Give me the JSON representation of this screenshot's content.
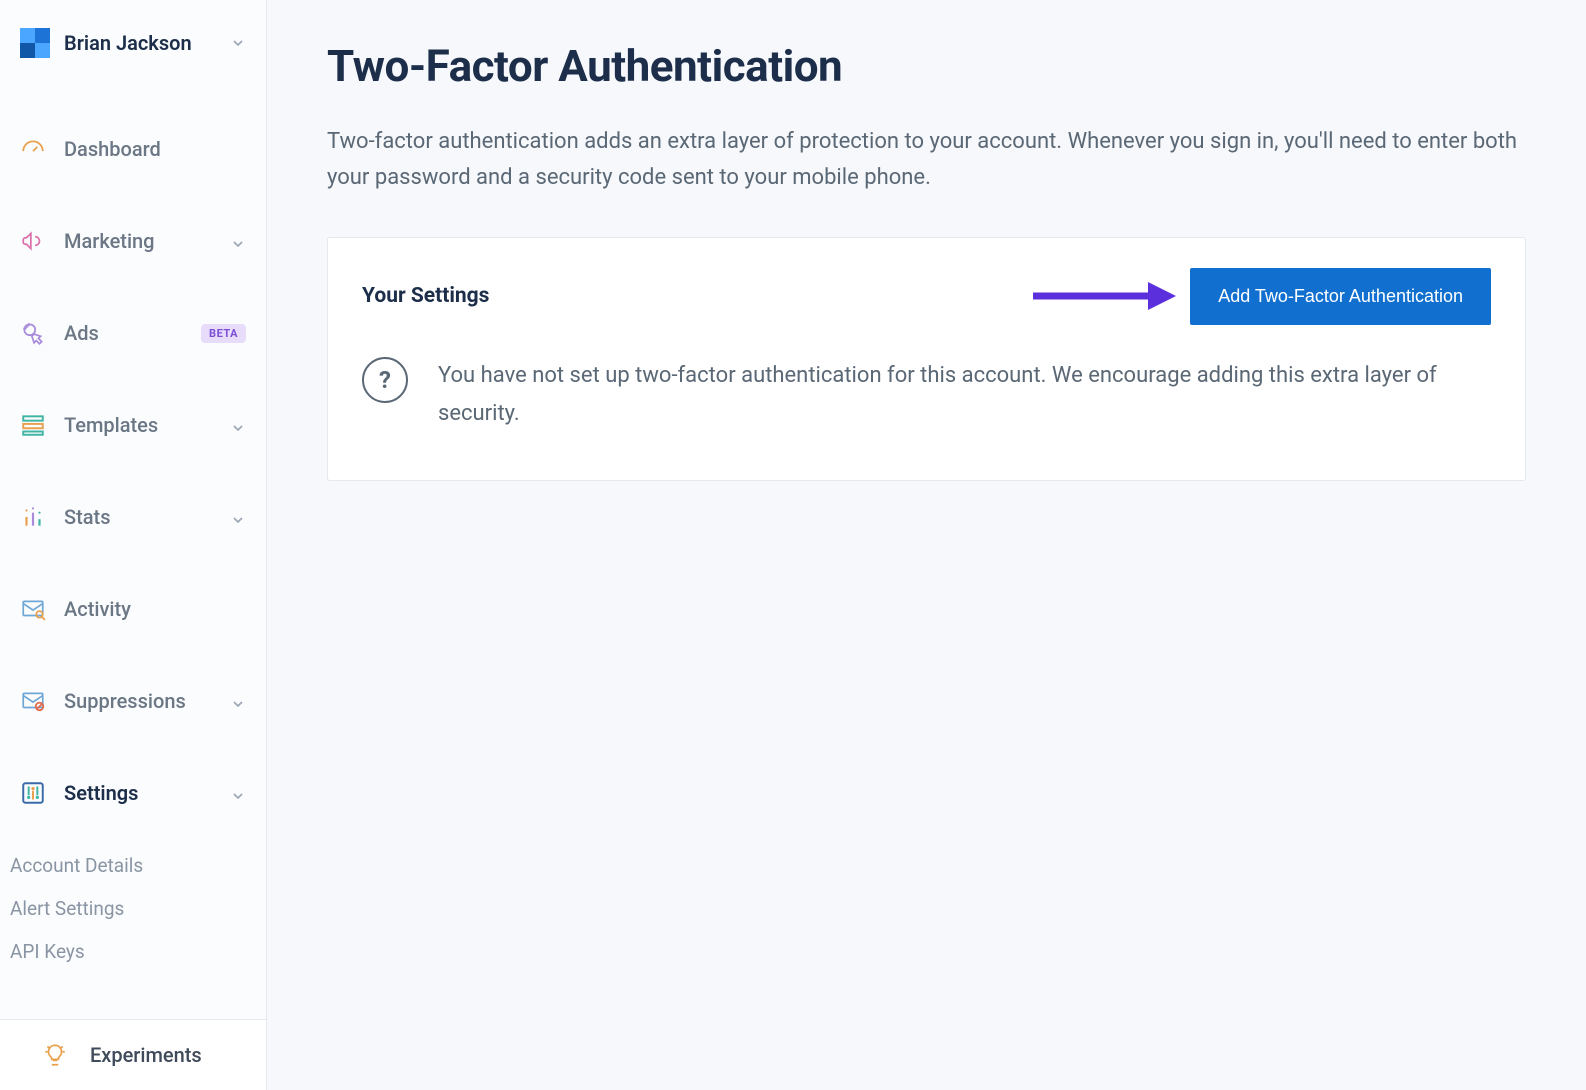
{
  "user": {
    "name": "Brian Jackson"
  },
  "sidebar": {
    "items": [
      {
        "label": "Dashboard",
        "expandable": false
      },
      {
        "label": "Marketing",
        "expandable": true
      },
      {
        "label": "Ads",
        "badge": "BETA",
        "expandable": false
      },
      {
        "label": "Templates",
        "expandable": true
      },
      {
        "label": "Stats",
        "expandable": true
      },
      {
        "label": "Activity",
        "expandable": false
      },
      {
        "label": "Suppressions",
        "expandable": true
      },
      {
        "label": "Settings",
        "expandable": true,
        "active": true
      }
    ],
    "settings_sub": [
      "Account Details",
      "Alert Settings",
      "API Keys"
    ],
    "footer": {
      "label": "Experiments"
    }
  },
  "page": {
    "title": "Two-Factor Authentication",
    "description": "Two-factor authentication adds an extra layer of protection to your account. Whenever you sign in, you'll need to enter both your password and a security code sent to your mobile phone."
  },
  "settings_card": {
    "heading": "Your Settings",
    "cta": "Add Two-Factor Authentication",
    "message": "You have not set up two-factor authentication for this account. We encourage adding this extra layer of security."
  },
  "colors": {
    "accent_blue": "#1170cf",
    "annotation_purple": "#5b2fdb"
  }
}
